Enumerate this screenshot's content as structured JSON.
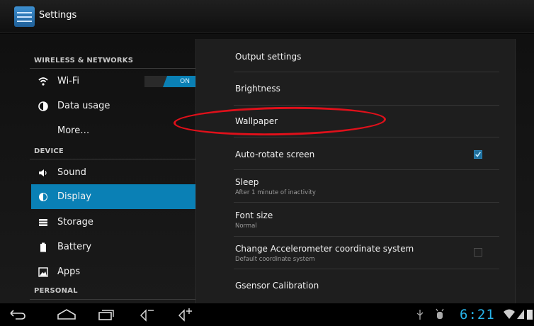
{
  "app": {
    "title": "Settings"
  },
  "sidebar": {
    "categories": {
      "wireless": "WIRELESS & NETWORKS",
      "device": "DEVICE",
      "personal": "PERSONAL"
    },
    "items": [
      {
        "label": "Wi-Fi",
        "toggle": "ON",
        "icon": "wifi-icon"
      },
      {
        "label": "Data usage",
        "icon": "data-usage-icon"
      },
      {
        "label": "More…"
      },
      {
        "label": "Sound",
        "icon": "speaker-icon"
      },
      {
        "label": "Display",
        "icon": "brightness-icon",
        "selected": true
      },
      {
        "label": "Storage",
        "icon": "storage-icon"
      },
      {
        "label": "Battery",
        "icon": "battery-icon"
      },
      {
        "label": "Apps",
        "icon": "apps-icon"
      }
    ]
  },
  "display": {
    "items": [
      {
        "title": "Output settings"
      },
      {
        "title": "Brightness"
      },
      {
        "title": "Wallpaper"
      },
      {
        "title": "Auto-rotate screen",
        "checked": true
      },
      {
        "title": "Sleep",
        "summary": "After 1 minute of inactivity"
      },
      {
        "title": "Font size",
        "summary": "Normal"
      },
      {
        "title": "Change Accelerometer coordinate system",
        "summary": "Default coordinate system",
        "checked": false
      },
      {
        "title": "Gsensor Calibration"
      }
    ]
  },
  "statusbar": {
    "time": "6:21"
  },
  "colors": {
    "accent": "#0a80b5",
    "highlight_ellipse": "#e0101a",
    "clock": "#27b4ea"
  }
}
